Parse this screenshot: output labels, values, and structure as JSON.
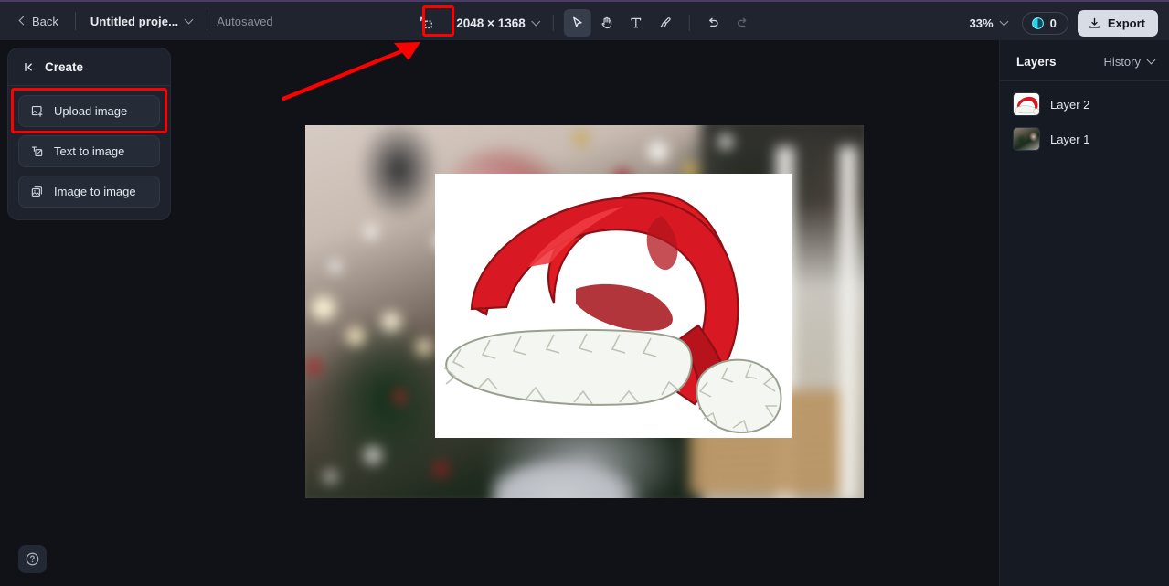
{
  "app": {
    "accent_purple": "#4d3a66",
    "header_bg": "#1f242e",
    "canvas_bg": "#111218",
    "panel_bg": "#1d222c",
    "annotation_color": "#ff0000"
  },
  "header": {
    "back_label": "Back",
    "project_name": "Untitled proje...",
    "autosaved_label": "Autosaved",
    "canvas_size": "2048 × 1368",
    "zoom_level": "33%",
    "credits_count": "0",
    "export_label": "Export",
    "tools": [
      {
        "name": "resize-canvas-icon",
        "label": "Resize canvas",
        "active": false
      },
      {
        "name": "select-tool-icon",
        "label": "Select",
        "active": true
      },
      {
        "name": "hand-tool-icon",
        "label": "Pan",
        "active": false
      },
      {
        "name": "text-tool-icon",
        "label": "Text",
        "active": false
      },
      {
        "name": "brush-tool-icon",
        "label": "Brush",
        "active": false
      },
      {
        "name": "undo-icon",
        "label": "Undo",
        "active": false
      },
      {
        "name": "redo-icon",
        "label": "Redo",
        "active": false
      }
    ]
  },
  "create_panel": {
    "title": "Create",
    "collapse_icon": "collapse-left-icon",
    "items": [
      {
        "label": "Upload image",
        "icon": "upload-image-icon",
        "highlighted": true
      },
      {
        "label": "Text to image",
        "icon": "text-to-image-icon",
        "highlighted": false
      },
      {
        "label": "Image to image",
        "icon": "image-to-image-icon",
        "highlighted": false
      }
    ]
  },
  "layers_panel": {
    "title": "Layers",
    "history_label": "History",
    "layers": [
      {
        "name": "Layer 2",
        "thumb": "santa-hat"
      },
      {
        "name": "Layer 1",
        "thumb": "christmas-photo"
      }
    ]
  },
  "help": {
    "icon": "question-mark-icon",
    "label": "Help"
  },
  "annotations": {
    "upload_box_label": "highlight-upload-image",
    "toolbar_box_label": "highlight-resize-canvas",
    "arrow_label": "pointer-arrow-to-resize-canvas"
  }
}
